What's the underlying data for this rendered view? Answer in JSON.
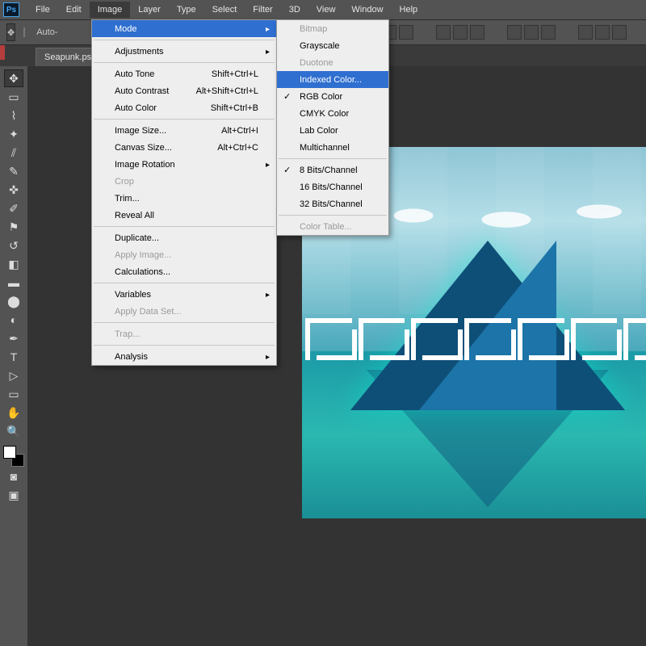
{
  "menubar": {
    "items": [
      "File",
      "Edit",
      "Image",
      "Layer",
      "Type",
      "Select",
      "Filter",
      "3D",
      "View",
      "Window",
      "Help"
    ],
    "active_index": 2
  },
  "optbar": {
    "auto_label": "Auto-"
  },
  "doc_tab": {
    "title": "Seapunk.ps"
  },
  "image_menu": {
    "mode": "Mode",
    "adjustments": "Adjustments",
    "auto_tone": "Auto Tone",
    "auto_tone_sc": "Shift+Ctrl+L",
    "auto_contrast": "Auto Contrast",
    "auto_contrast_sc": "Alt+Shift+Ctrl+L",
    "auto_color": "Auto Color",
    "auto_color_sc": "Shift+Ctrl+B",
    "image_size": "Image Size...",
    "image_size_sc": "Alt+Ctrl+I",
    "canvas_size": "Canvas Size...",
    "canvas_size_sc": "Alt+Ctrl+C",
    "image_rotation": "Image Rotation",
    "crop": "Crop",
    "trim": "Trim...",
    "reveal_all": "Reveal All",
    "duplicate": "Duplicate...",
    "apply_image": "Apply Image...",
    "calculations": "Calculations...",
    "variables": "Variables",
    "apply_data_set": "Apply Data Set...",
    "trap": "Trap...",
    "analysis": "Analysis"
  },
  "mode_menu": {
    "bitmap": "Bitmap",
    "grayscale": "Grayscale",
    "duotone": "Duotone",
    "indexed": "Indexed Color...",
    "rgb": "RGB Color",
    "cmyk": "CMYK Color",
    "lab": "Lab Color",
    "multichannel": "Multichannel",
    "b8": "8 Bits/Channel",
    "b16": "16 Bits/Channel",
    "b32": "32 Bits/Channel",
    "color_table": "Color Table...",
    "checked_mode": "rgb",
    "checked_bits": "b8",
    "highlighted": "indexed",
    "disabled": [
      "bitmap",
      "duotone",
      "color_table"
    ]
  }
}
